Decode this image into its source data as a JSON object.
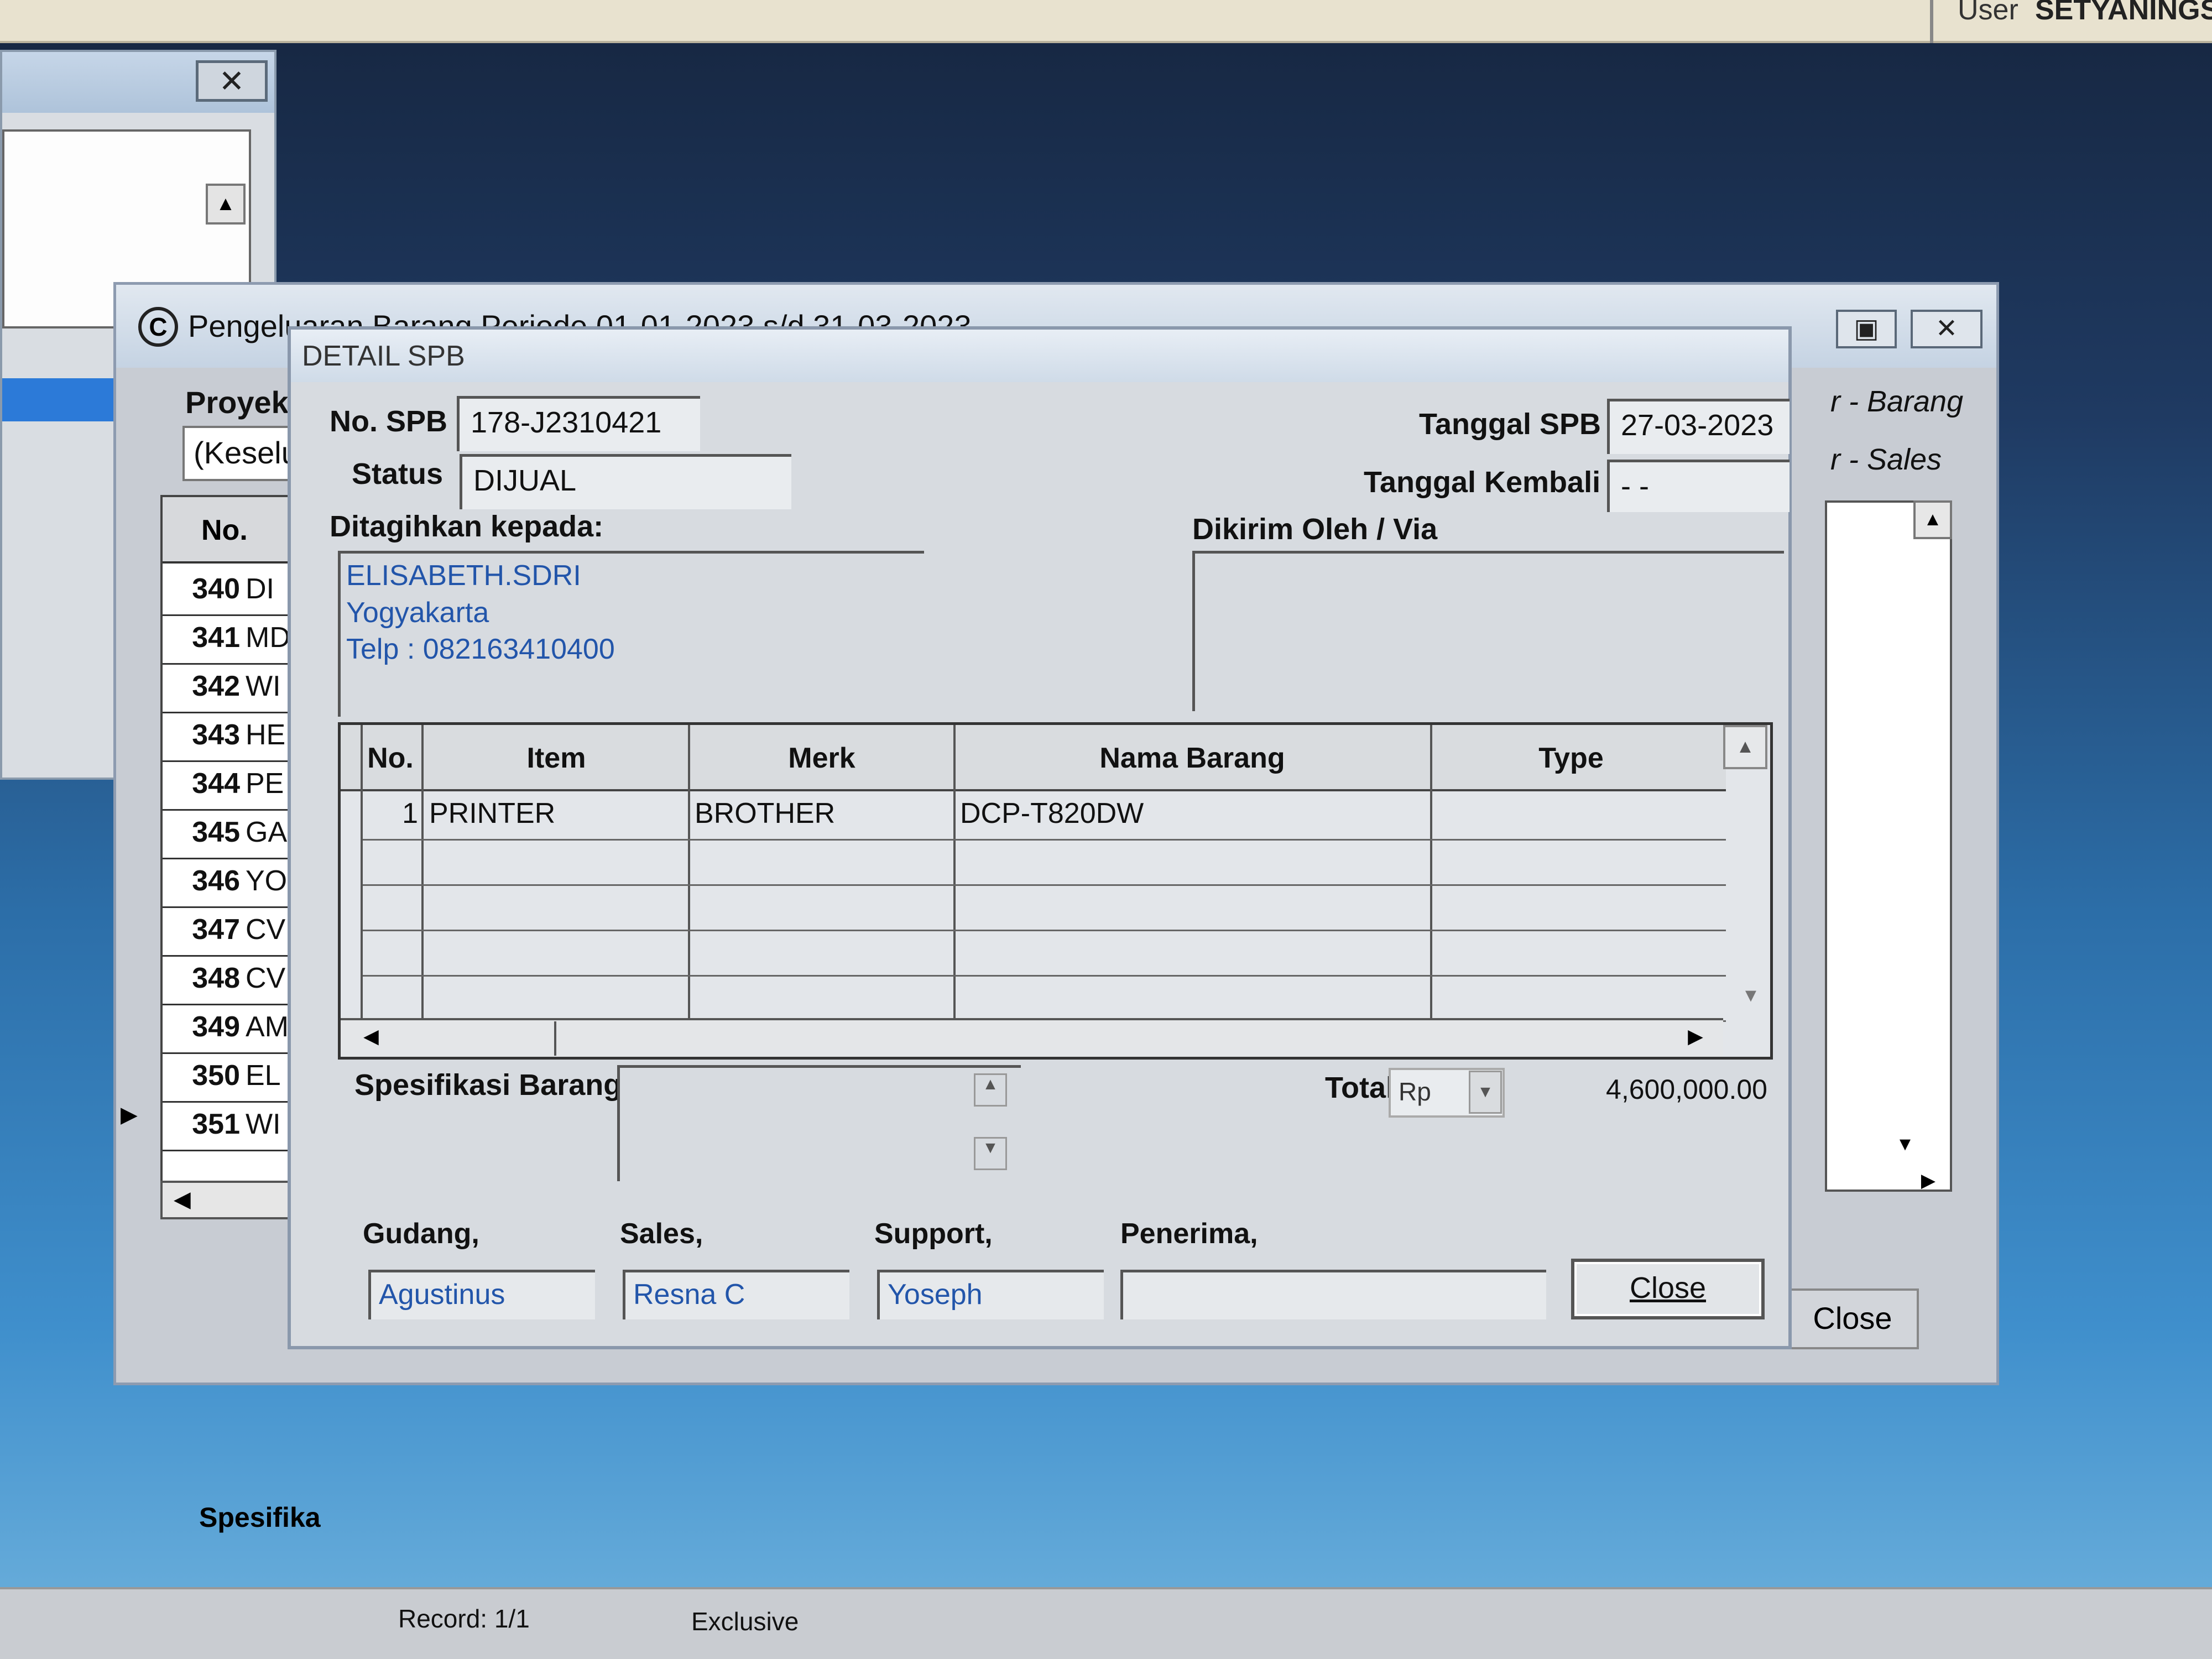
{
  "topbar": {
    "user_label": "User",
    "user_value": "SETYANINGSI"
  },
  "left_window": {
    "close_glyph": "✕",
    "scroll_up_glyph": "▲"
  },
  "main_window": {
    "title": "Pengeluaran Barang Periode 01-01-2023 s/d 31-03-2023",
    "icon_letter": "C",
    "max_glyph": "▣",
    "close_glyph": "✕",
    "proyek_label": "Proyek",
    "proyek_value": "(Keseluruhan)",
    "grid": {
      "no_header": "No.",
      "rows": [
        {
          "no": "340",
          "code": "DI"
        },
        {
          "no": "341",
          "code": "MD"
        },
        {
          "no": "342",
          "code": "WI"
        },
        {
          "no": "343",
          "code": "HE"
        },
        {
          "no": "344",
          "code": "PE"
        },
        {
          "no": "345",
          "code": "GA"
        },
        {
          "no": "346",
          "code": "YO"
        },
        {
          "no": "347",
          "code": "CV"
        },
        {
          "no": "348",
          "code": "CV"
        },
        {
          "no": "349",
          "code": "AM"
        },
        {
          "no": "350",
          "code": "EL"
        },
        {
          "no": "351",
          "code": "WI"
        }
      ],
      "current_row_marker": "▶"
    },
    "spesifikasi_label": "Spesifika",
    "right_barang": "r - Barang",
    "right_sales": "r - Sales",
    "close_label": "Close"
  },
  "statusbar": {
    "record": "Record: 1/1",
    "mode": "Exclusive"
  },
  "dialog": {
    "title": "DETAIL SPB",
    "no_spb_label": "No. SPB",
    "no_spb_value": "178-J2310421",
    "status_label": "Status",
    "status_value": "DIJUAL",
    "tanggal_spb_label": "Tanggal SPB",
    "tanggal_spb_value": "27-03-2023",
    "tanggal_kembali_label": "Tanggal Kembali",
    "tanggal_kembali_value": "- -",
    "ditagihkan_label": "Ditagihkan kepada:",
    "address_lines": [
      "ELISABETH.SDRI",
      "Yogyakarta",
      "Telp : 082163410400"
    ],
    "dikirim_label": "Dikirim Oleh / Via",
    "items_table": {
      "columns": [
        "No.",
        "Item",
        "Merk",
        "Nama Barang",
        "Type"
      ],
      "rows": [
        {
          "no": "1",
          "item": "PRINTER",
          "merk": "BROTHER",
          "nama_barang": "DCP-T820DW",
          "type": ""
        }
      ]
    },
    "spesifikasi_label": "Spesifikasi Barang",
    "total_label": "Total",
    "currency": "Rp",
    "total_value": "4,600,000.00",
    "gudang_label": "Gudang,",
    "gudang_value": "Agustinus",
    "sales_label": "Sales,",
    "sales_value": "Resna C",
    "support_label": "Support,",
    "support_value": "Yoseph",
    "penerima_label": "Penerima,",
    "penerima_value": "",
    "close_button": "Close"
  }
}
